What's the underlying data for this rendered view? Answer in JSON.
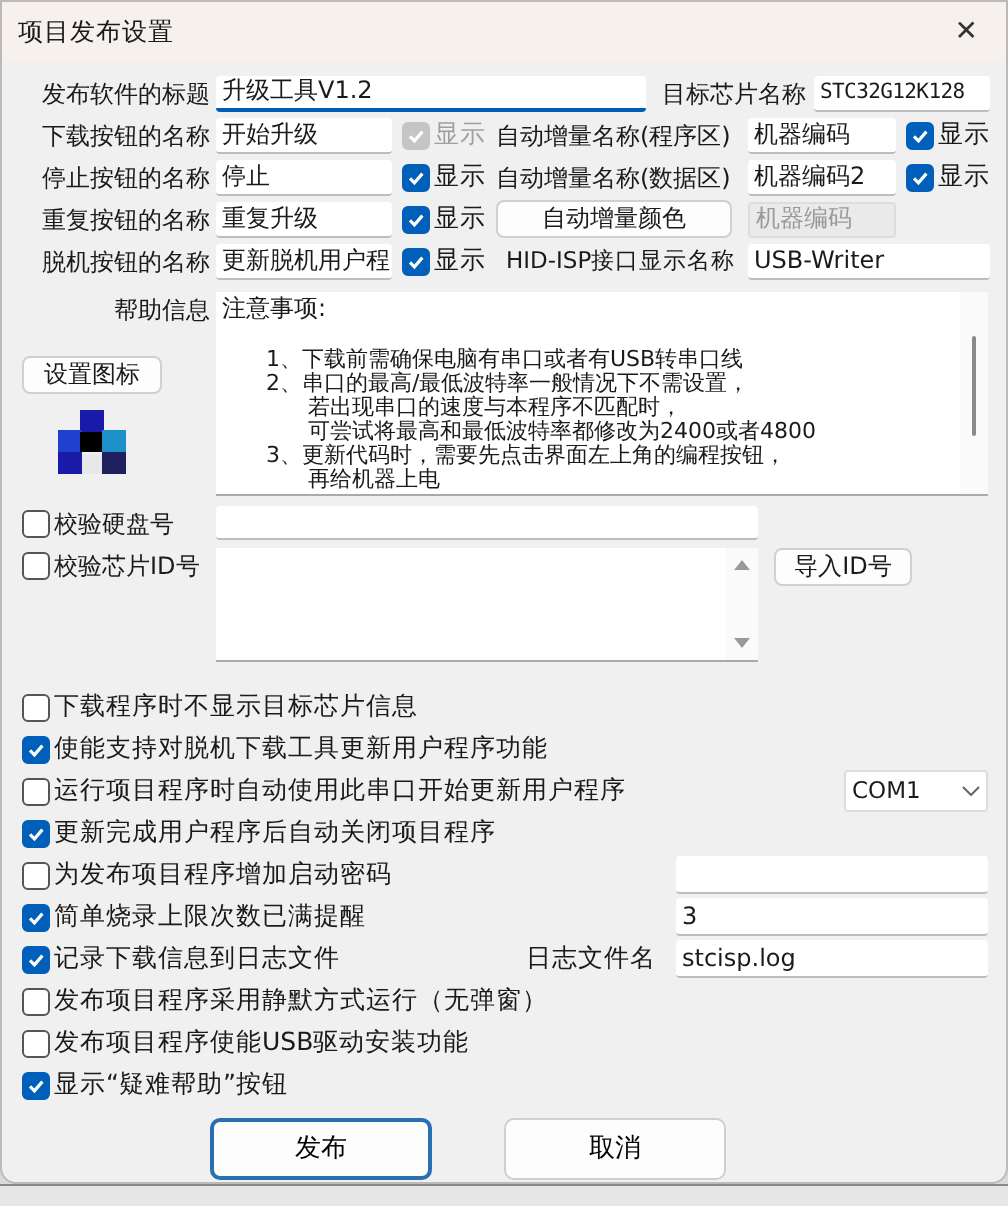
{
  "window": {
    "title": "项目发布设置",
    "close": "✕"
  },
  "rows": [
    {
      "label": "发布软件的标题",
      "value": "升级工具V1.2",
      "focused": true,
      "right": {
        "kind": "field",
        "label": "目标芯片名称",
        "value": "STC32G12K128"
      }
    },
    {
      "label": "下载按钮的名称",
      "value": "开始升级",
      "show": {
        "label": "显示",
        "checked": true,
        "disabled": true
      },
      "right": {
        "kind": "field",
        "label": "自动增量名称(程序区)",
        "value": "机器编码",
        "show": {
          "label": "显示",
          "checked": true,
          "disabled": false
        }
      }
    },
    {
      "label": "停止按钮的名称",
      "value": "停止",
      "show": {
        "label": "显示",
        "checked": true,
        "disabled": false
      },
      "right": {
        "kind": "field",
        "label": "自动增量名称(数据区)",
        "value": "机器编码2",
        "show": {
          "label": "显示",
          "checked": true,
          "disabled": false
        }
      }
    },
    {
      "label": "重复按钮的名称",
      "value": "重复升级",
      "show": {
        "label": "显示",
        "checked": true,
        "disabled": false
      },
      "right": {
        "kind": "button",
        "label": "自动增量颜色",
        "value": "机器编码",
        "disabled": true
      }
    },
    {
      "label": "脱机按钮的名称",
      "value": "更新脱机用户程",
      "show": {
        "label": "显示",
        "checked": true,
        "disabled": false
      },
      "right": {
        "kind": "wide",
        "label": "HID-ISP接口显示名称",
        "value": "USB-Writer"
      }
    }
  ],
  "help": {
    "label": "帮助信息",
    "icon_button": "设置图标",
    "lines": [
      {
        "kind": "heading",
        "text": "注意事项:"
      },
      {
        "kind": "item",
        "text": "1、下载前需确保电脑有串口或者有USB转串口线"
      },
      {
        "kind": "item",
        "text": "2、串口的最高/最低波特率一般情况下不需设置，"
      },
      {
        "kind": "continuation",
        "text": "若出现串口的速度与本程序不匹配时，"
      },
      {
        "kind": "continuation",
        "text": "可尝试将最高和最低波特率都修改为2400或者4800"
      },
      {
        "kind": "item",
        "text": "3、更新代码时，需要先点击界面左上角的编程按钮，"
      },
      {
        "kind": "continuation",
        "text": "再给机器上电"
      }
    ]
  },
  "verify": [
    {
      "kind": "line",
      "label": "校验硬盘号",
      "checked": false
    },
    {
      "kind": "area",
      "label": "校验芯片ID号",
      "checked": false,
      "button": "导入ID号"
    }
  ],
  "options": [
    {
      "label": "下载程序时不显示目标芯片信息",
      "checked": false
    },
    {
      "label": "使能支持对脱机下载工具更新用户程序功能",
      "checked": true
    },
    {
      "label": "运行项目程序时自动使用此串口开始更新用户程序",
      "checked": false,
      "extra": {
        "kind": "select",
        "value": "COM1"
      }
    },
    {
      "label": "更新完成用户程序后自动关闭项目程序",
      "checked": true
    },
    {
      "label": "为发布项目程序增加启动密码",
      "checked": false,
      "extra": {
        "kind": "input"
      }
    },
    {
      "label": "简单烧录上限次数已满提醒",
      "checked": true,
      "extra": {
        "kind": "input",
        "value": "3"
      }
    },
    {
      "label": "记录下载信息到日志文件",
      "checked": true,
      "extra": {
        "kind": "input",
        "label": "日志文件名",
        "value": "stcisp.log"
      }
    },
    {
      "label": "发布项目程序采用静默方式运行（无弹窗）",
      "checked": false
    },
    {
      "label": "发布项目程序使能USB驱动安装功能",
      "checked": false
    },
    {
      "label": "显示“疑难帮助”按钮",
      "checked": true
    }
  ],
  "actions": [
    {
      "label": "发布",
      "default": true
    },
    {
      "label": "取消",
      "default": false
    }
  ]
}
